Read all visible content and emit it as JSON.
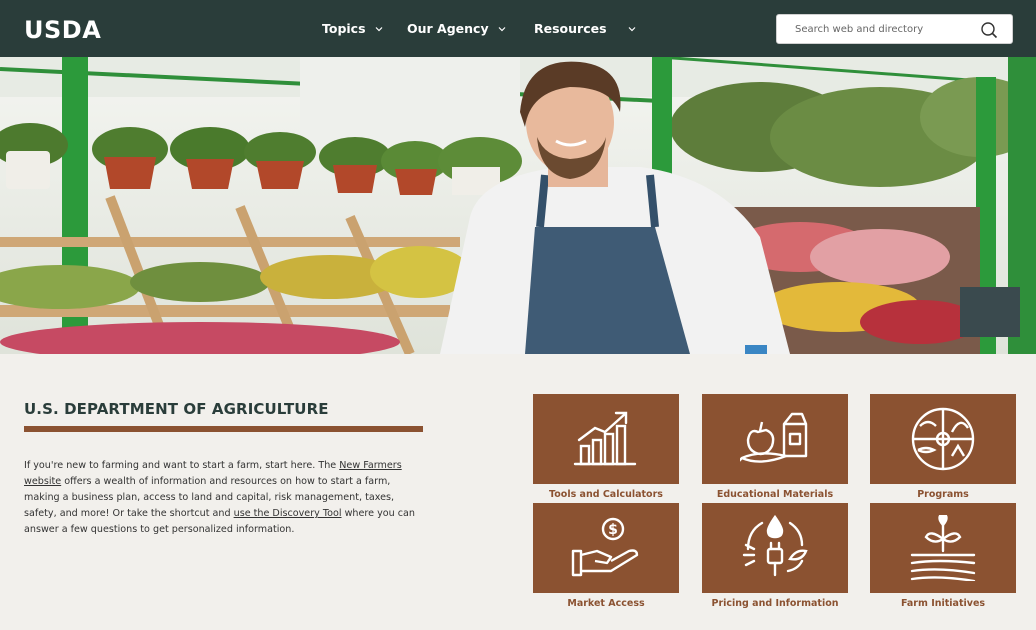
{
  "header": {
    "logo": "USDA",
    "nav": [
      {
        "label": "Topics"
      },
      {
        "label": "Our Agency"
      },
      {
        "label": "Resources"
      }
    ],
    "search": {
      "placeholder": "Search web and directory"
    }
  },
  "hero": {
    "alt": "Smiling man in apron in a greenhouse"
  },
  "main": {
    "title": "U.S. DEPARTMENT OF AGRICULTURE",
    "intro": {
      "p1": "If you're new to farming and want to start a farm, start here. The ",
      "link1": "New Farmers website",
      "p2": " offers a wealth of information and resources on how to start a farm, making a business plan, access to land and capital, risk management, taxes, safety, and more! Or take the shortcut and ",
      "link2": "use the Discovery Tool",
      "p3": " where you can answer a few questions to get personalized information."
    },
    "tiles": [
      {
        "label": "Tools and Calculators",
        "icon": "chart-growth-icon"
      },
      {
        "label": "Educational Materials",
        "icon": "food-produce-icon"
      },
      {
        "label": "Programs",
        "icon": "farm-circle-icon"
      },
      {
        "label": "Market Access",
        "icon": "hand-money-icon"
      },
      {
        "label": "Pricing and Information",
        "icon": "energy-plug-icon"
      },
      {
        "label": "Farm Initiatives",
        "icon": "plant-field-icon"
      }
    ]
  },
  "colors": {
    "header": "#2a3d3a",
    "accent": "#8b5231",
    "background": "#f2f0ec"
  }
}
